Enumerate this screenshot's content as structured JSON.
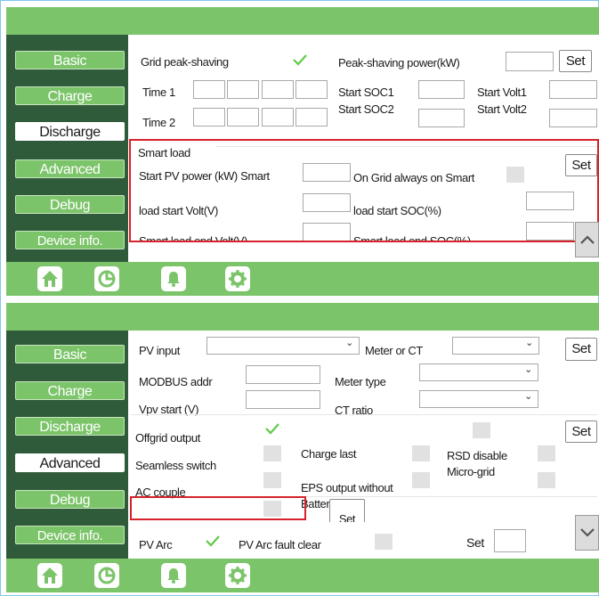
{
  "nav": {
    "basic": "Basic",
    "charge": "Charge",
    "discharge": "Discharge",
    "advanced": "Advanced",
    "debug": "Debug",
    "device_info": "Device info."
  },
  "bottom_tabs": [
    "home-icon",
    "chart-icon",
    "bell-icon",
    "gear-icon"
  ],
  "colors": {
    "green": "#7cc46a",
    "dark_green": "#2f5b3b",
    "highlight": "#d6222a"
  },
  "discharge_page": {
    "active_tab": "Discharge",
    "grid_peak_shaving_label": "Grid peak-shaving",
    "grid_peak_shaving_checked": true,
    "peak_shaving_power_label": "Peak-shaving power(kW)",
    "set_label": "Set",
    "time1_label": "Time 1",
    "time2_label": "Time 2",
    "start_soc1_label": "Start SOC1",
    "start_soc2_label": "Start SOC2",
    "start_volt1_label": "Start Volt1",
    "start_volt2_label": "Start Volt2",
    "smart_load_header": "Smart load",
    "start_pv_power_label": "Start PV power (kW)  Smart",
    "on_grid_always_on_label": "On  Grid  always  on  Smart",
    "load_start_volt_label": "load start Volt(V)",
    "load_start_soc_label": "load start SOC(%)",
    "smart_load_end_volt_label": "Smart load end Volt(V)",
    "smart_load_end_soc_label": "Smart load end SOC(%)"
  },
  "advanced_page": {
    "active_tab": "Advanced",
    "pv_input_label": "PV input",
    "meter_or_ct_label": "Meter or CT",
    "set_label": "Set",
    "modbus_addr_label": "MODBUS addr",
    "meter_type_label": "Meter type",
    "vpv_start_label": "Vpv start (V)",
    "ct_ratio_label": "CT ratio",
    "offgrid_output_label": "Offgrid output",
    "offgrid_output_checked": true,
    "charge_last_label": "Charge last",
    "rsd_disable_label": "RSD disable",
    "micro_grid_label": "Micro-grid",
    "seamless_switch_label": "Seamless switch",
    "ac_couple_label": "AC couple",
    "eps_output_label": "EPS output  without",
    "battery_label": "Battery",
    "pv_arc_label": "PV Arc",
    "pv_arc_checked": true,
    "pv_arc_fault_clear_label": "PV Arc fault clear",
    "bottom_set_label": "Set"
  }
}
